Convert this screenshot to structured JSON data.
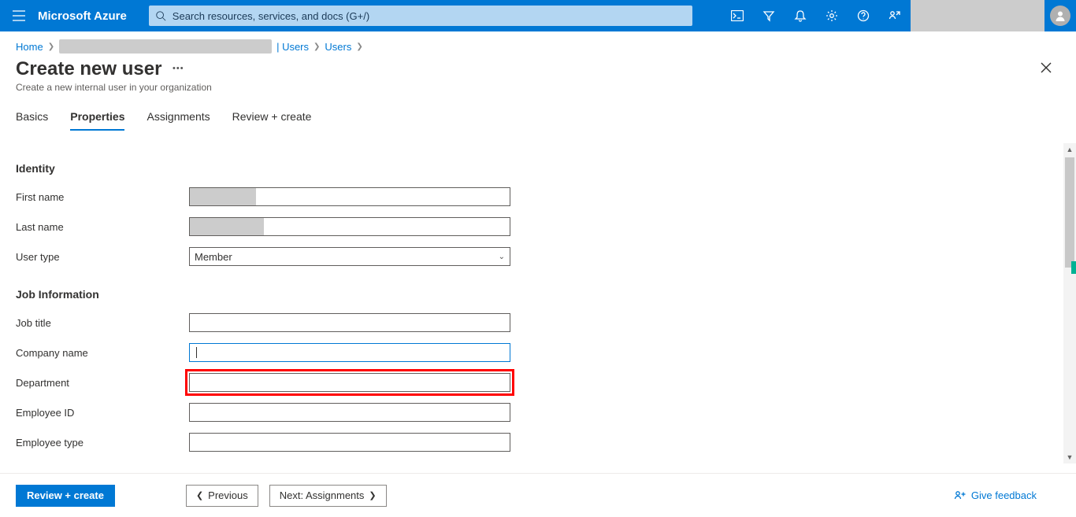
{
  "topbar": {
    "brand": "Microsoft Azure",
    "search_placeholder": "Search resources, services, and docs (G+/)",
    "colors": {
      "bg": "#0078d4",
      "search_bg": "#b3d6f2"
    }
  },
  "breadcrumb": {
    "items": [
      "Home",
      "",
      "| Users",
      "Users"
    ]
  },
  "header": {
    "title": "Create new user",
    "subtitle": "Create a new internal user in your organization"
  },
  "tabs": {
    "items": [
      "Basics",
      "Properties",
      "Assignments",
      "Review + create"
    ],
    "active_index": 1
  },
  "form": {
    "sections": {
      "identity": {
        "title": "Identity",
        "first_name_label": "First name",
        "first_name_value": "",
        "last_name_label": "Last name",
        "last_name_value": "",
        "user_type_label": "User type",
        "user_type_value": "Member"
      },
      "job": {
        "title": "Job Information",
        "job_title_label": "Job title",
        "job_title_value": "",
        "company_name_label": "Company name",
        "company_name_value": "",
        "department_label": "Department",
        "department_value": "",
        "employee_id_label": "Employee ID",
        "employee_id_value": "",
        "employee_type_label": "Employee type",
        "employee_type_value": ""
      }
    }
  },
  "footer": {
    "primary": "Review + create",
    "previous": "Previous",
    "next": "Next: Assignments",
    "feedback": "Give feedback"
  }
}
